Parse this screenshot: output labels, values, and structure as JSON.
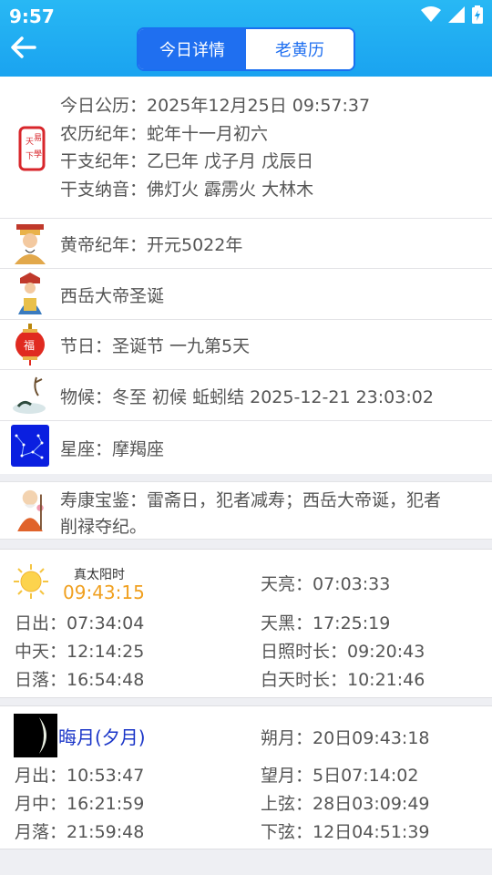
{
  "status": {
    "time": "9:57"
  },
  "header": {
    "tab_today": "今日详情",
    "tab_almanac": "老黄历"
  },
  "calendar": {
    "lines": [
      "今日公历：2025年12月25日 09:57:37",
      "农历纪年：蛇年十一月初六",
      "干支纪年：乙巳年 戊子月 戊辰日",
      "干支纳音：佛灯火 霹雳火 大林木"
    ],
    "seal_chars": "天下易学"
  },
  "rows": {
    "emperor": "黄帝纪年：开元5022年",
    "deity": "西岳大帝圣诞",
    "festival": "节日：圣诞节 一九第5天",
    "phenology": "物候：冬至 初候 蚯蚓结 2025-12-21 23:03:02",
    "zodiac": "星座：摩羯座",
    "longevity_line1": "寿康宝鉴：雷斋日，犯者减寿；西岳大帝诞，犯者",
    "longevity_line2": "削禄夺纪。"
  },
  "sun": {
    "true_solar_label": "真太阳时",
    "true_solar_time": "09:43:15",
    "dawn": "天亮：07:03:33",
    "sunrise": "日出：07:34:04",
    "dusk": "天黑：17:25:19",
    "noon": "中天：12:14:25",
    "sunshine": "日照时长：09:20:43",
    "sunset": "日落：16:54:48",
    "daylight": "白天时长：10:21:46"
  },
  "moon": {
    "phase": "晦月(夕月)",
    "new_moon": "朔月：20日09:43:18",
    "moonrise": "月出：10:53:47",
    "full_moon": "望月：5日07:14:02",
    "transit": "月中：16:21:59",
    "first_quarter": "上弦：28日03:09:49",
    "moonset": "月落：21:59:48",
    "last_quarter": "下弦：12日04:51:39"
  },
  "colors": {
    "header": "#1aa3f0",
    "accent_blue": "#1f6ff0",
    "orange": "#f0a020",
    "moon_text": "#1a35c8"
  }
}
